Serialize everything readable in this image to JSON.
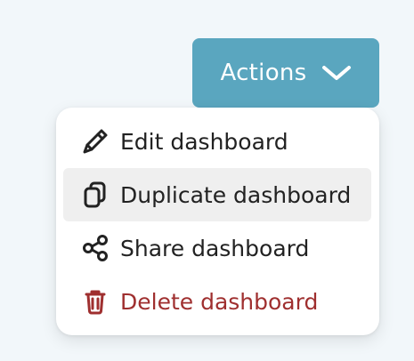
{
  "actions_button": {
    "label": "Actions",
    "color": "#5aa6bf"
  },
  "menu": {
    "items": [
      {
        "label": "Edit dashboard",
        "icon": "pencil-icon"
      },
      {
        "label": "Duplicate dashboard",
        "icon": "copy-icon"
      },
      {
        "label": "Share dashboard",
        "icon": "share-icon"
      },
      {
        "label": "Delete dashboard",
        "icon": "trash-icon",
        "color": "#9f2f2f"
      }
    ]
  }
}
